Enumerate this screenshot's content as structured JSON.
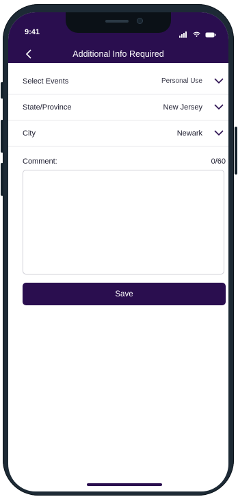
{
  "colors": {
    "accent": "#2a0e4f",
    "text": "#1c1c2e",
    "divider": "#e7e7ea"
  },
  "status_bar": {
    "time": "9:41",
    "icons": [
      "signal-icon",
      "wifi-icon",
      "battery-icon"
    ]
  },
  "header": {
    "title": "Additional Info Required",
    "back_icon": "chevron-left-icon"
  },
  "form": {
    "rows": [
      {
        "label": "Select Events",
        "value": "Personal Use",
        "icon": "chevron-down-icon"
      },
      {
        "label": "State/Province",
        "value": "New Jersey",
        "icon": "chevron-down-icon"
      },
      {
        "label": "City",
        "value": "Newark",
        "icon": "chevron-down-icon"
      }
    ],
    "comment": {
      "label": "Comment:",
      "counter": "0/60",
      "value": ""
    },
    "save_label": "Save"
  }
}
